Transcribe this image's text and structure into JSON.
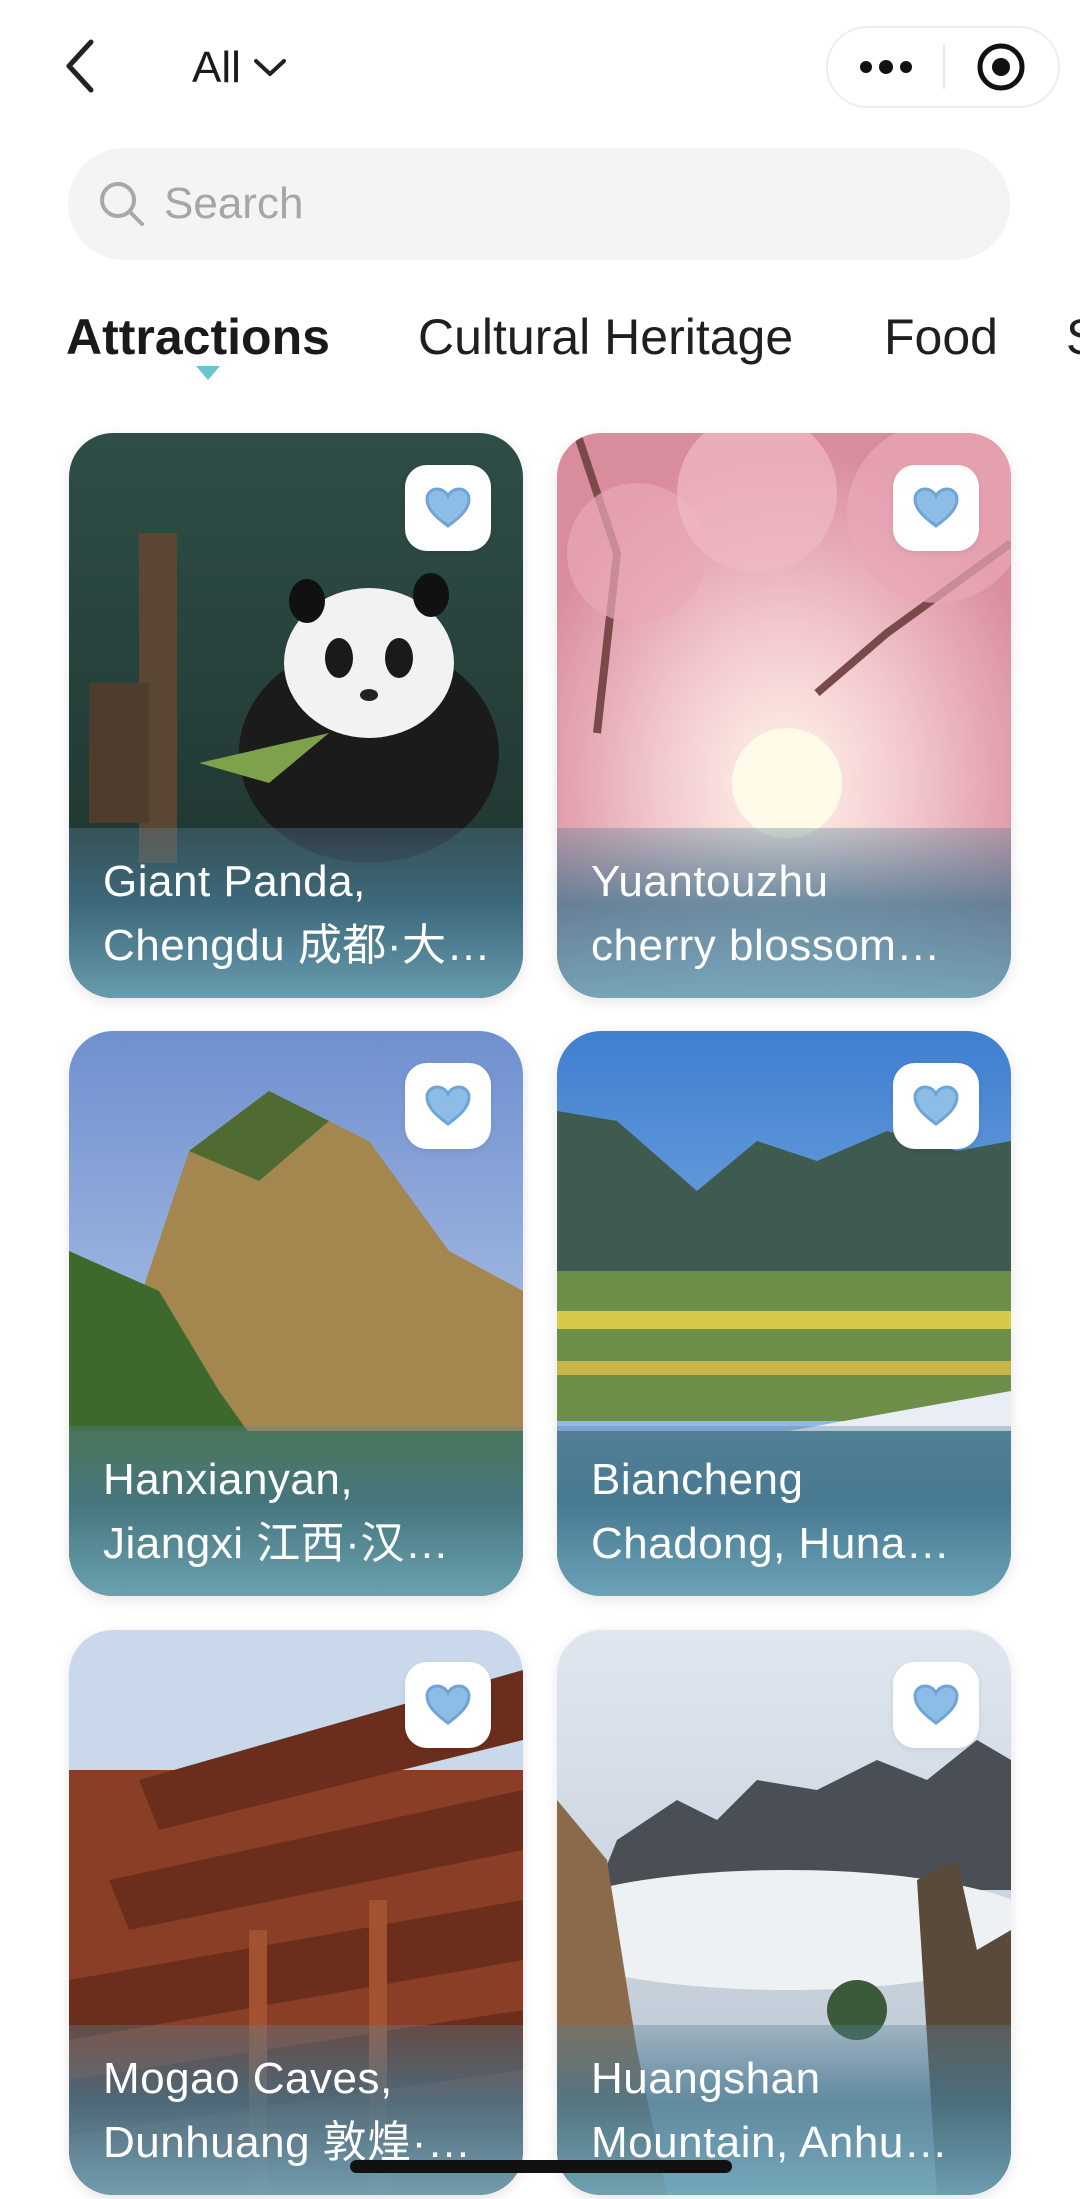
{
  "header": {
    "filter_label": "All"
  },
  "search": {
    "placeholder": "Search"
  },
  "tabs": [
    {
      "label": "Attractions",
      "active": true
    },
    {
      "label": "Cultural Heritage",
      "active": false
    },
    {
      "label": "Food",
      "active": false
    },
    {
      "label": "S",
      "active": false
    }
  ],
  "cards": [
    {
      "line1": "Giant  Panda,",
      "line2": "Chengdu 成都·大…",
      "icon": "heart-icon"
    },
    {
      "line1": "Yuantouzhu",
      "line2": "cherry  blossom…",
      "icon": "heart-icon"
    },
    {
      "line1": "Hanxianyan,",
      "line2": "Jiangxi 江西·汉仙岩",
      "icon": "heart-icon"
    },
    {
      "line1": "Biancheng",
      "line2": "Chadong, Huna…",
      "icon": "heart-icon"
    },
    {
      "line1": "Mogao  Caves,",
      "line2": "Dunhuang 敦煌·…",
      "icon": "heart-icon"
    },
    {
      "line1": "Huangshan",
      "line2": "Mountain,  Anhu…",
      "icon": "heart-icon"
    }
  ],
  "colors": {
    "accent": "#6cc4d3",
    "heart": "#7fb3e0"
  }
}
